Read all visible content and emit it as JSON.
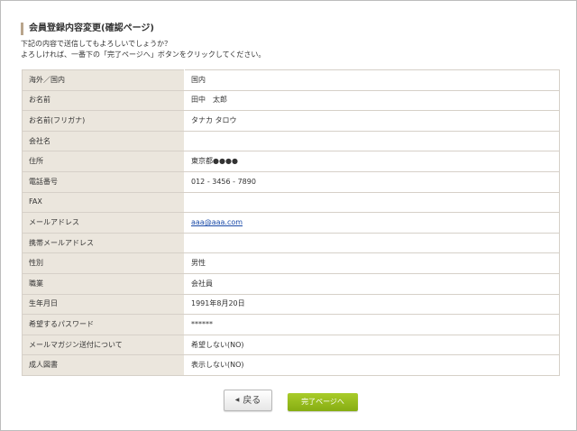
{
  "page": {
    "title": "会員登録内容変更(確認ページ)",
    "intro_line1": "下記の内容で送信してもよろしいでしょうか？",
    "intro_line2": "よろしければ、一番下の「完了ページへ」ボタンをクリックしてください。"
  },
  "rows": [
    {
      "label": "海外／国内",
      "value": "国内"
    },
    {
      "label": "お名前",
      "value": "田中　太郎"
    },
    {
      "label": "お名前(フリガナ)",
      "value": "タナカ タロウ"
    },
    {
      "label": "会社名",
      "value": ""
    },
    {
      "label": "住所",
      "value": "東京都●●●●"
    },
    {
      "label": "電話番号",
      "value": "012 - 3456 - 7890"
    },
    {
      "label": "FAX",
      "value": ""
    },
    {
      "label": "メールアドレス",
      "value": "aaa@aaa.com"
    },
    {
      "label": "携帯メールアドレス",
      "value": ""
    },
    {
      "label": "性別",
      "value": "男性"
    },
    {
      "label": "職業",
      "value": "会社員"
    },
    {
      "label": "生年月日",
      "value": "1991年8月20日"
    },
    {
      "label": "希望するパスワード",
      "value": "******"
    },
    {
      "label": "メールマガジン送付について",
      "value": "希望しない(NO)"
    },
    {
      "label": "成人図書",
      "value": "表示しない(NO)"
    }
  ],
  "buttons": {
    "back_label": "戻る",
    "back_icon": "triangle-left-icon",
    "complete_label": "完了ページへ"
  },
  "colors": {
    "label_bg": "#ebe6dd",
    "title_accent": "#b9a58c",
    "complete_button": "#93b81a",
    "link": "#1a4aa8"
  }
}
